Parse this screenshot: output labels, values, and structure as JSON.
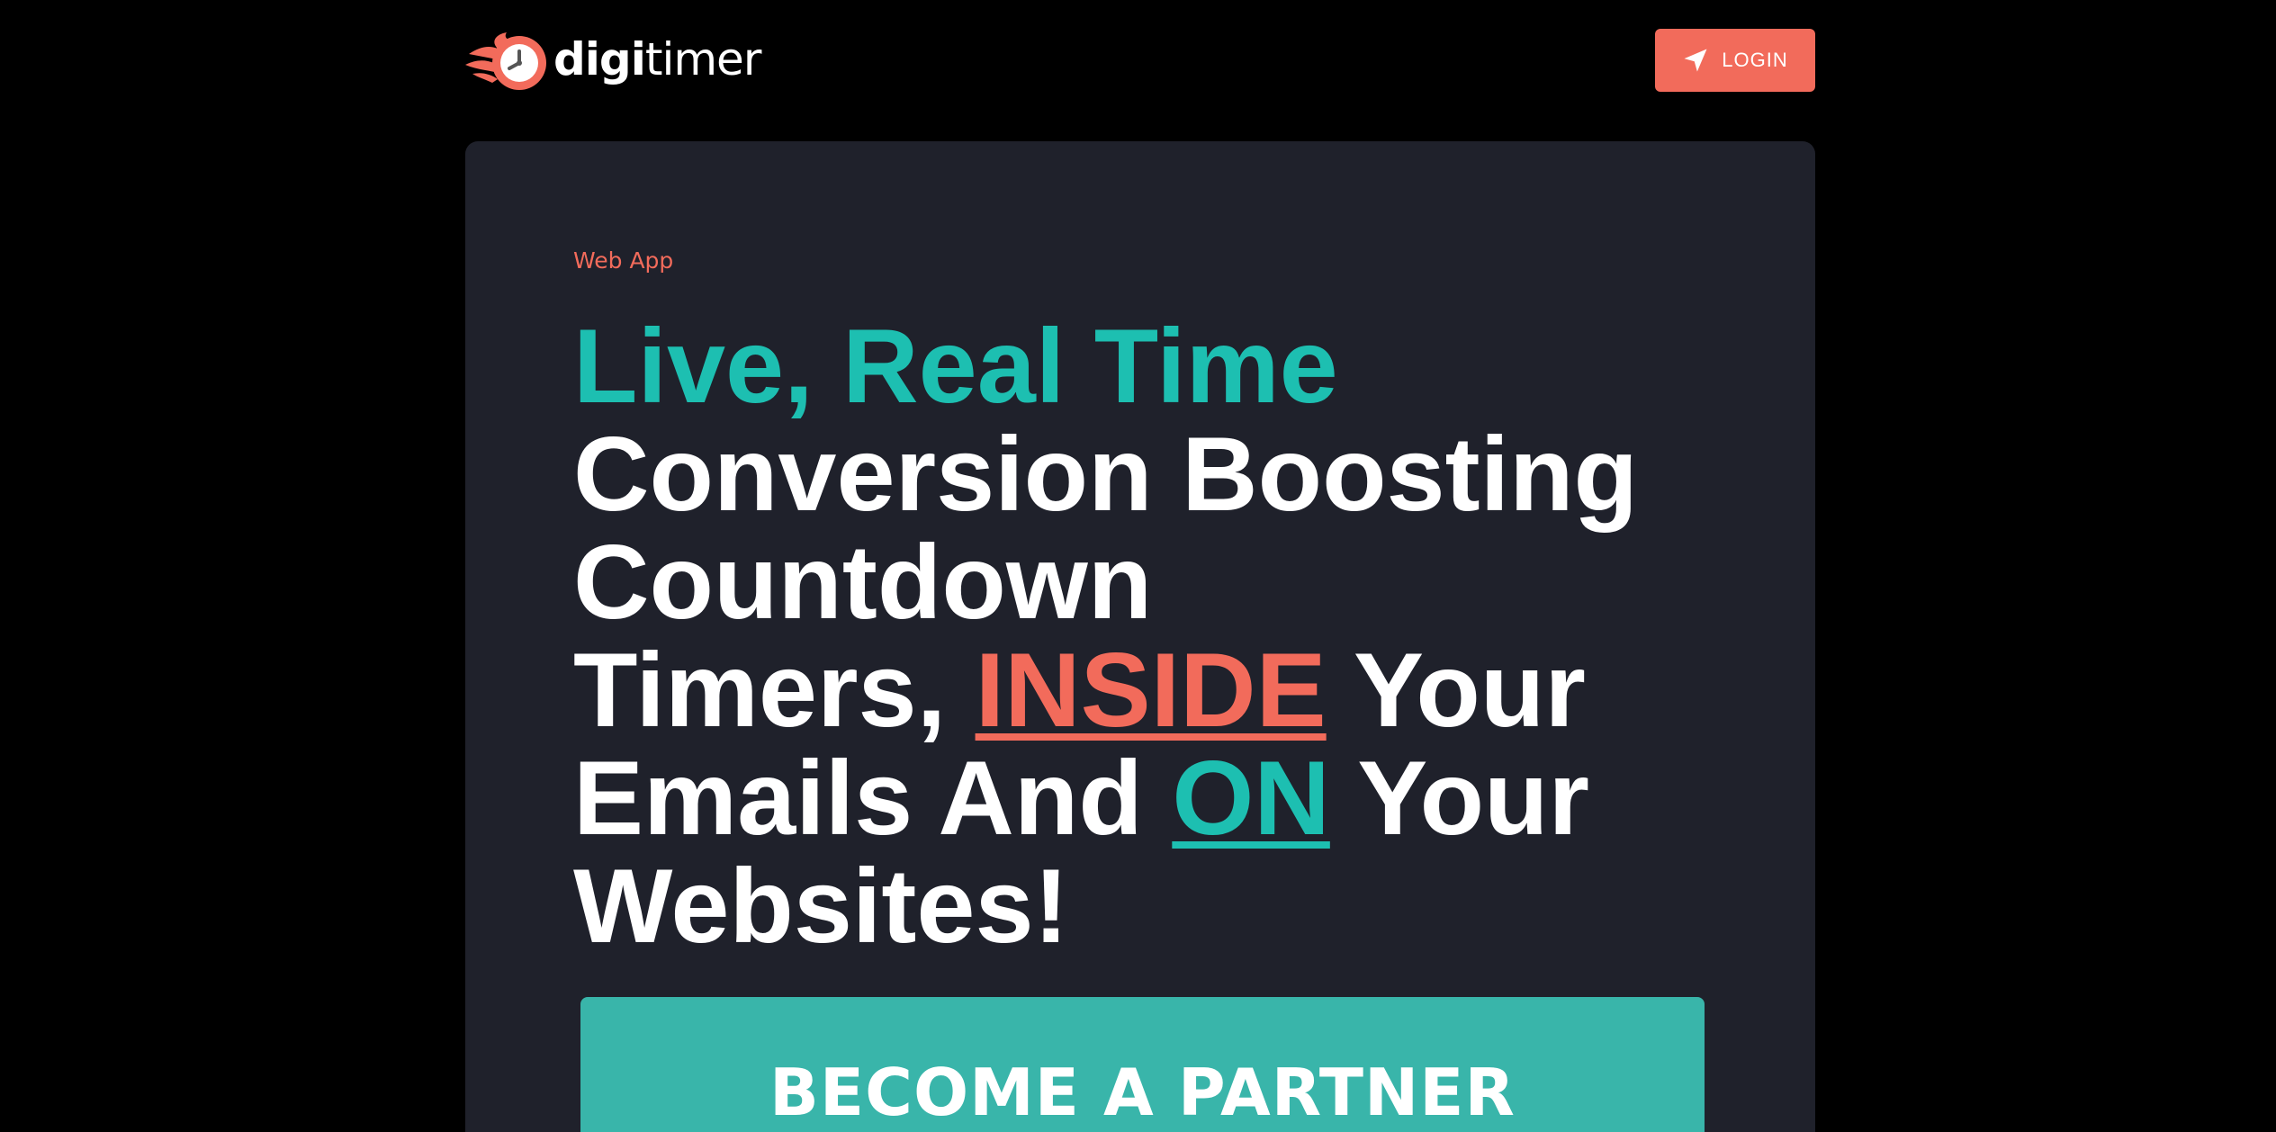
{
  "header": {
    "logo_bold": "digi",
    "logo_light": "timer",
    "login_label": "LOGIN"
  },
  "hero": {
    "kicker": "Web App",
    "line1": "Live, Real Time",
    "line2": "Conversion Boosting",
    "line3": "Countdown",
    "line4_start": "Timers, ",
    "line4_highlight": "INSIDE",
    "line4_end": " Your",
    "line5_start": "Emails And ",
    "line5_highlight": "ON",
    "line5_end": " Your",
    "line6": "Websites!",
    "cta_label": "BECOME A PARTNER"
  },
  "colors": {
    "background": "#000000",
    "card": "#1f212b",
    "accent_coral": "#f26b5b",
    "accent_teal": "#1dbfb1",
    "cta_teal": "#39b5aa"
  },
  "icons": {
    "logo": "flaming-clock-icon",
    "login": "navigation-arrow-icon"
  }
}
